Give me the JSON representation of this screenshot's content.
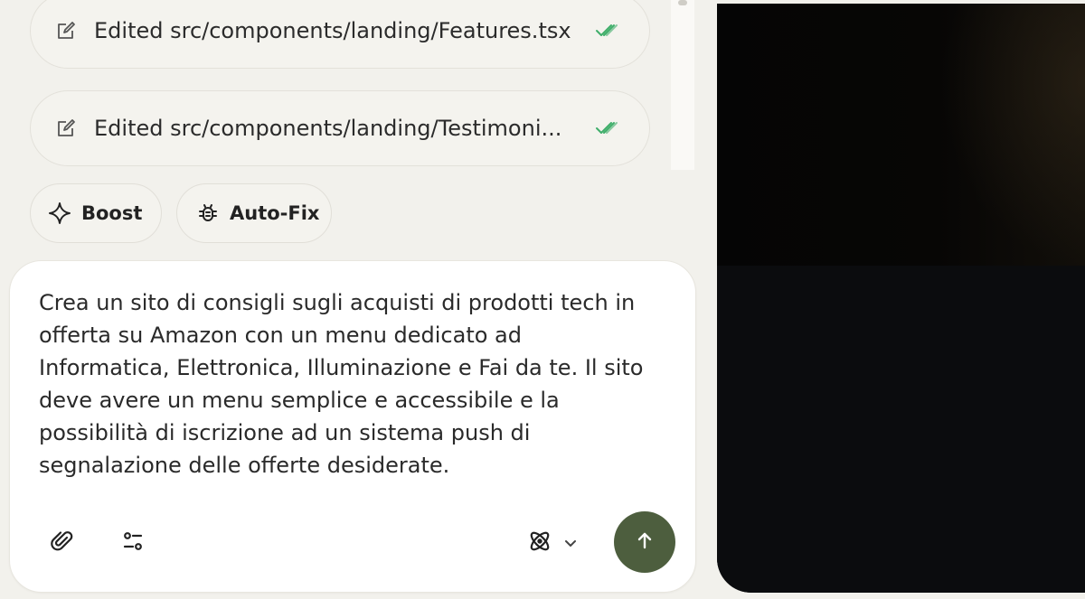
{
  "activity": {
    "items": [
      {
        "label": "Edited src/components/landing/Features.tsx",
        "icon": "edit-file-icon",
        "status_icon": "double-check-icon"
      },
      {
        "label": "Edited src/components/landing/Testimoni...",
        "icon": "edit-file-icon",
        "status_icon": "double-check-icon"
      }
    ]
  },
  "actions": {
    "boost_label": "Boost",
    "autofix_label": "Auto-Fix"
  },
  "composer": {
    "text": "Crea un sito di consigli sugli acquisti di prodotti tech in\nofferta su Amazon con un menu dedicato ad\nInformatica, Elettronica, Illuminazione e Fai da te. Il sito\ndeve avere un menu semplice e accessibile e la\npossibilità di iscrizione ad un sistema push di\nsegnalazione delle offerte desiderate.",
    "attach_icon": "paperclip-icon",
    "settings_icon": "sliders-icon",
    "model_icon": "atom-icon",
    "send_icon": "arrow-up-icon"
  },
  "colors": {
    "background": "#f2f1ec",
    "send_button": "#4d5e3e",
    "check": "#3fae6a",
    "preview": "#0d0d0f"
  }
}
